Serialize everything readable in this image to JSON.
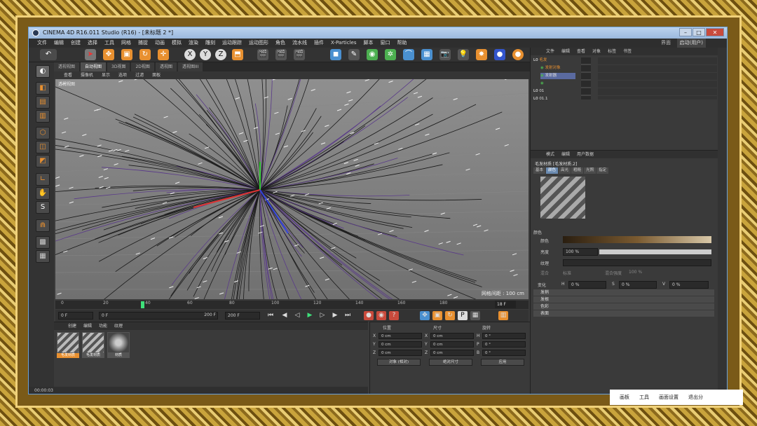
{
  "window": {
    "title": "CINEMA 4D R16.011 Studio (R16) - [未标题 2 *]",
    "controls": [
      "–",
      "□",
      "✕"
    ]
  },
  "menubar": [
    "文件",
    "编辑",
    "创建",
    "选择",
    "工具",
    "网格",
    "捕捉",
    "动画",
    "模拟",
    "渲染",
    "雕刻",
    "运动跟踪",
    "运动图形",
    "角色",
    "流水线",
    "插件",
    "X-Particles",
    "脚本",
    "窗口",
    "帮助"
  ],
  "layout": {
    "label": "界面",
    "value": "启动(用户)"
  },
  "viewport": {
    "tabs": [
      "透视视图",
      "自动视图",
      "3D视图",
      "2D视图",
      "透视图",
      "透视图III"
    ],
    "active_tab": 1,
    "menu": [
      "查看",
      "摄像机",
      "显示",
      "选项",
      "过滤",
      "面板"
    ],
    "label": "透视视图",
    "grid_label": "网格间距 : 100 cm"
  },
  "timeline": {
    "ticks": [
      "0",
      "20",
      "40",
      "60",
      "80",
      "100",
      "120",
      "140",
      "160",
      "180"
    ],
    "frame_display": "18 F"
  },
  "transport": {
    "start": "0 F",
    "field2": "0 F",
    "field3": "200 F",
    "end": "200 F"
  },
  "materials": {
    "menu": [
      "创建",
      "编辑",
      "功能",
      "纹理"
    ],
    "items": [
      {
        "name": "毛发材质",
        "selected": true
      },
      {
        "name": "毛发材质",
        "selected": false
      },
      {
        "name": "材质",
        "selected": false
      }
    ]
  },
  "coordinates": {
    "headers": [
      "位置",
      "尺寸",
      "旋转"
    ],
    "rows": [
      {
        "axis": "X",
        "pos": "0 cm",
        "size_axis": "X",
        "size": "0 cm",
        "rot_axis": "H",
        "rot": "0 °"
      },
      {
        "axis": "Y",
        "pos": "0 cm",
        "size_axis": "Y",
        "size": "0 cm",
        "rot_axis": "P",
        "rot": "0 °"
      },
      {
        "axis": "Z",
        "pos": "0 cm",
        "size_axis": "Z",
        "size": "0 cm",
        "rot_axis": "B",
        "rot": "0 °"
      }
    ],
    "mode1": "对象 (相对)",
    "mode2": "绝对尺寸",
    "apply": "应用"
  },
  "status": "00:00:03",
  "object_manager": {
    "menu": [
      "文件",
      "编辑",
      "查看",
      "对象",
      "标签",
      "书签"
    ],
    "rows": [
      "毛发",
      "发射对象",
      "发射器",
      "01",
      "01.1"
    ]
  },
  "attributes": {
    "menu": [
      "模式",
      "编辑",
      "用户数据"
    ],
    "title": "毛发材质 [毛发材质.2]",
    "tabs": [
      "基本",
      "颜色",
      "高光",
      "粗糙",
      "光照",
      "指定"
    ],
    "active_tab": 1,
    "section_color": "颜色",
    "color_label": "颜色",
    "brightness_label": "亮度",
    "brightness_value": "100 %",
    "texture_label": "纹理",
    "mix_label": "混合",
    "mix_mode": "标准",
    "mix_strength_label": "混合强度",
    "mix_strength": "100 %",
    "variation_label": "变化",
    "h_label": "H",
    "h_val": "0 %",
    "s_label": "S",
    "s_val": "0 %",
    "v_label": "V",
    "v_val": "0 %",
    "sections": [
      "发梢",
      "发根",
      "色彩",
      "表面"
    ]
  },
  "taskbar": [
    "画板",
    "工具",
    "画面设置",
    "退出分"
  ]
}
